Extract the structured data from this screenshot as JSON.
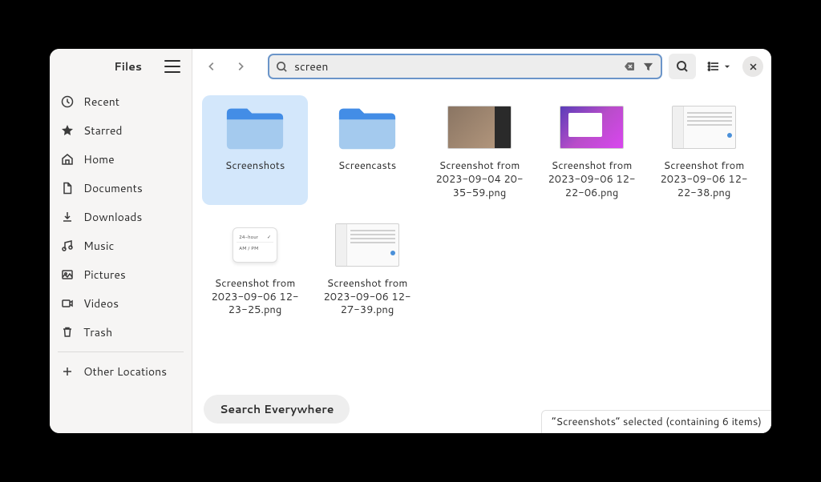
{
  "sidebar": {
    "title": "Files",
    "items": [
      {
        "icon": "clock",
        "label": "Recent"
      },
      {
        "icon": "star",
        "label": "Starred"
      },
      {
        "icon": "home",
        "label": "Home"
      },
      {
        "icon": "document",
        "label": "Documents"
      },
      {
        "icon": "download",
        "label": "Downloads"
      },
      {
        "icon": "music",
        "label": "Music"
      },
      {
        "icon": "pictures",
        "label": "Pictures"
      },
      {
        "icon": "videos",
        "label": "Videos"
      },
      {
        "icon": "trash",
        "label": "Trash"
      }
    ],
    "other_locations": "Other Locations"
  },
  "search": {
    "value": "screen"
  },
  "items": [
    {
      "type": "folder",
      "label": "Screenshots",
      "selected": true
    },
    {
      "type": "folder",
      "label": "Screencasts"
    },
    {
      "type": "screenshot",
      "variant": "photo",
      "label": "Screenshot from 2023-09-04 20-35-59.png"
    },
    {
      "type": "screenshot",
      "variant": "purple",
      "label": "Screenshot from 2023-09-06 12-22-06.png"
    },
    {
      "type": "screenshot",
      "variant": "ui",
      "label": "Screenshot from 2023-09-06 12-22-38.png"
    },
    {
      "type": "screenshot",
      "variant": "clock",
      "label": "Screenshot from 2023-09-06 12-23-25.png"
    },
    {
      "type": "screenshot",
      "variant": "ui",
      "label": "Screenshot from 2023-09-06 12-27-39.png"
    }
  ],
  "clock_thumb": {
    "row1": "24-hour",
    "row2": "AM / PM"
  },
  "buttons": {
    "search_everywhere": "Search Everywhere"
  },
  "statusbar": "“Screenshots” selected  (containing 6 items)"
}
